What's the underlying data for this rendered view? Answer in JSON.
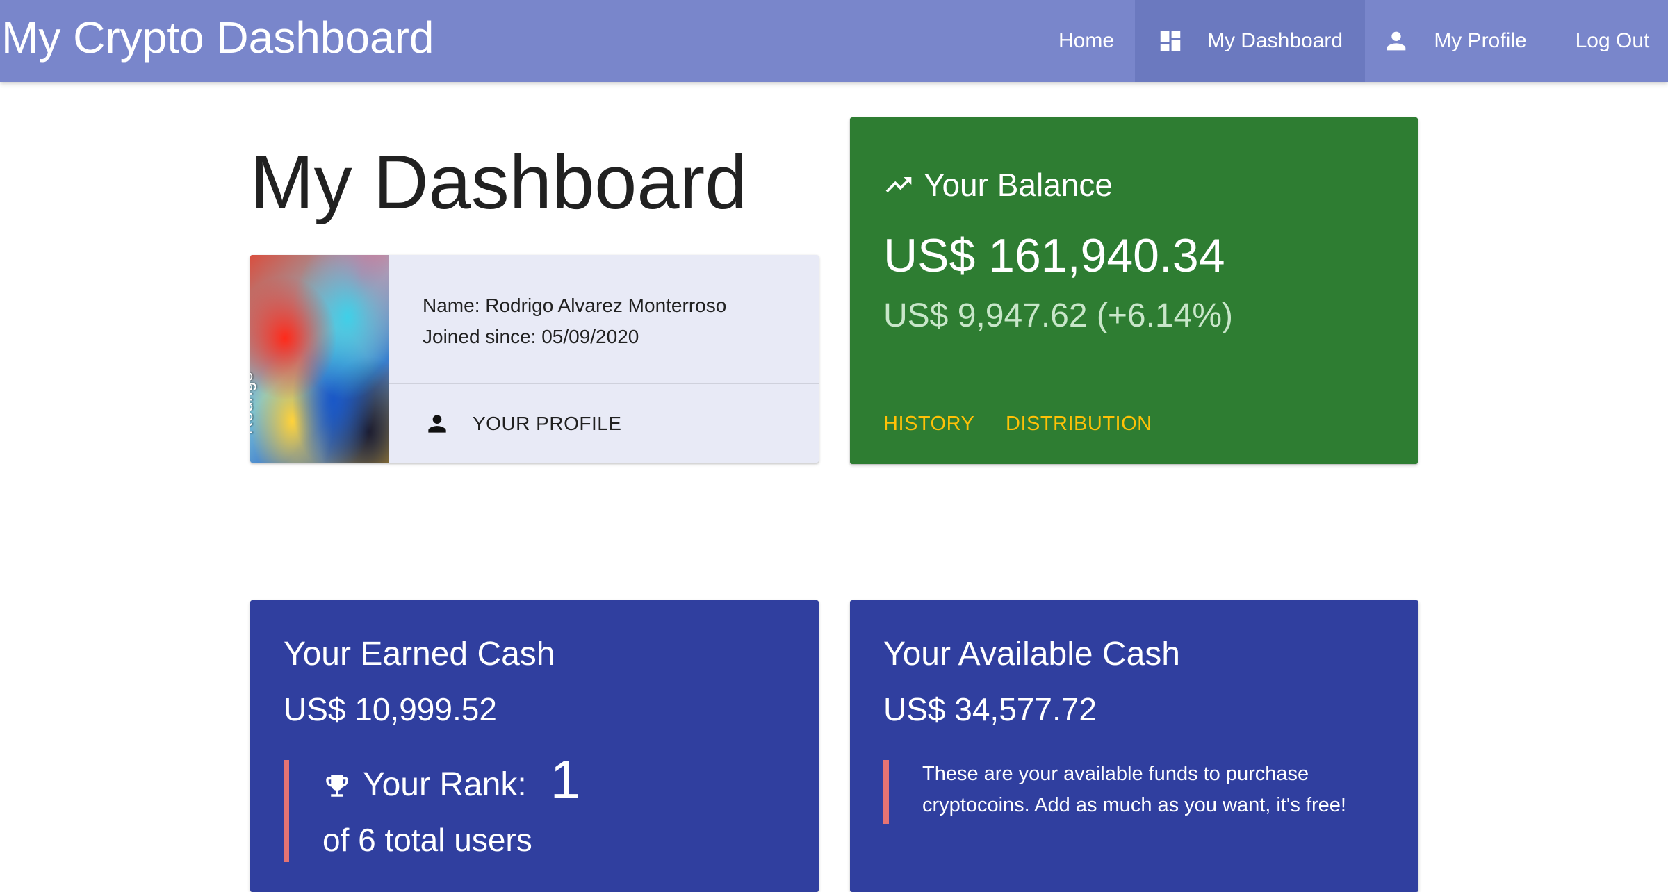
{
  "app": {
    "title": "My Crypto Dashboard"
  },
  "nav": {
    "home": "Home",
    "dashboard": "My Dashboard",
    "profile": "My Profile",
    "logout": "Log Out"
  },
  "page": {
    "title": "My Dashboard"
  },
  "profile_card": {
    "avatar_caption": "Rodrigo",
    "name_line": "Name: Rodrigo Alvarez Monterroso",
    "joined_line": "Joined since: 05/09/2020",
    "action_label": "YOUR PROFILE"
  },
  "balance": {
    "title": "Your Balance",
    "amount": "US$ 161,940.34",
    "change": "US$ 9,947.62 (+6.14%)",
    "actions": {
      "history": "HISTORY",
      "distribution": "DISTRIBUTION"
    }
  },
  "earned": {
    "title": "Your Earned Cash",
    "amount": "US$ 10,999.52",
    "rank_label": "Your Rank:",
    "rank_value": "1",
    "rank_total": "of 6 total users"
  },
  "available": {
    "title": "Your Available Cash",
    "amount": "US$ 34,577.72",
    "note": "These are your available funds to purchase cryptocoins. Add as much as you want, it's free!"
  },
  "colors": {
    "nav_bg": "#7986cb",
    "balance_bg": "#2e7d32",
    "cash_bg": "#303f9f",
    "accent_action": "#ffc107",
    "quote_bar": "#e57373"
  },
  "icons": {
    "dashboard": "dashboard-icon",
    "profile": "person-icon",
    "trend": "trending-up-icon",
    "rank": "trophy-icon"
  }
}
